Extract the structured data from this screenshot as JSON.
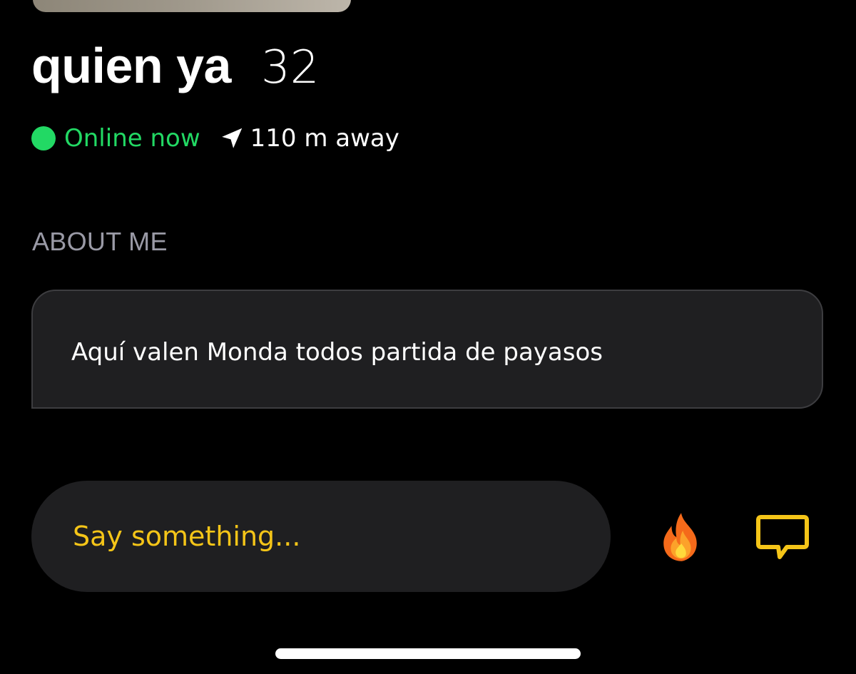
{
  "profile": {
    "name": "quien ya",
    "age": "32",
    "online_status": "Online now",
    "distance": "110 m away"
  },
  "about": {
    "label": "ABOUT ME",
    "text": "Aquí valen Monda todos partida de payasos"
  },
  "compose": {
    "placeholder": "Say something..."
  },
  "icons": {
    "status": "online-dot",
    "location": "location-arrow-icon",
    "tap": "fire-icon",
    "chat": "chat-bubble-icon"
  },
  "colors": {
    "background": "#000000",
    "online": "#22d964",
    "accent": "#f5c518",
    "card": "#1f1f21",
    "label": "#9a9aa6"
  }
}
